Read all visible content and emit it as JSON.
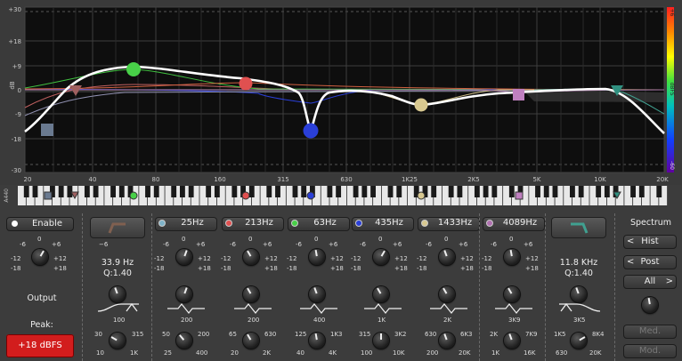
{
  "graph": {
    "y_labels": [
      "+30",
      "+18",
      "+9",
      "0",
      "-9",
      "-18",
      "-30"
    ],
    "db_label": "dB",
    "x_labels": [
      "20",
      "40",
      "80",
      "160",
      "315",
      "630",
      "1K25",
      "2K5",
      "5K",
      "10K",
      "20K"
    ],
    "scale_labels": [
      "+6",
      "0",
      "-6",
      "-12",
      "-18",
      "-24",
      "-30",
      "-36",
      "-42",
      "-48",
      "-54",
      "-60"
    ],
    "scale_unit": "dBFS",
    "keyboard_label": "A440",
    "curve_color": "#ffffff"
  },
  "left_panel": {
    "enable_label": "Enable",
    "output_label": "Output",
    "peak_label": "Peak:",
    "peak_value": "+18 dBFS",
    "gain_labels": [
      "-6",
      "0",
      "+6",
      "-12",
      "+12",
      "-18",
      "+18"
    ]
  },
  "bands": [
    {
      "freq_label": "25Hz",
      "color": "#7fb3c8"
    },
    {
      "freq_label": "213Hz",
      "color": "#e05050"
    },
    {
      "freq_label": "63Hz",
      "color": "#48d048"
    },
    {
      "freq_label": "435Hz",
      "color": "#2a3fd8"
    },
    {
      "freq_label": "1433Hz",
      "color": "#d8c890"
    },
    {
      "freq_label": "4089Hz",
      "color": "#b070b0"
    }
  ],
  "lowcut": {
    "freq": "33.9 Hz",
    "q": "Q:1.40",
    "q_labels": [
      "100"
    ],
    "freq_labels": [
      "30",
      "315",
      "10",
      "1K"
    ]
  },
  "highcut": {
    "freq": "11.8 KHz",
    "q": "Q:1.40",
    "q_labels": [
      "3K5"
    ],
    "freq_labels": [
      "1K5",
      "8K4",
      "630",
      "20K"
    ]
  },
  "band_knob_labels": [
    {
      "low": "50",
      "mid": "200",
      "hi": "100",
      "f1": "50",
      "f2": "200",
      "f3": "25",
      "f4": "400"
    },
    {
      "mid": "200",
      "f1": "65",
      "f2": "630",
      "f3": "20",
      "f4": "2K"
    },
    {
      "mid": "400",
      "f1": "125",
      "f2": "1K3",
      "f3": "40",
      "f4": "4K"
    },
    {
      "mid": "1K",
      "f1": "315",
      "f2": "3K2",
      "f3": "100",
      "f4": "10K"
    },
    {
      "mid": "2K",
      "f1": "630",
      "f2": "6K3",
      "f3": "200",
      "f4": "20K"
    },
    {
      "mid": "3K9",
      "f1": "2K",
      "f2": "7K9",
      "f3": "1K",
      "f4": "16K"
    }
  ],
  "spectrum": {
    "title": "Spectrum",
    "hist": "Hist",
    "post": "Post",
    "all": "All",
    "med1": "Med.",
    "med2": "Mod."
  }
}
